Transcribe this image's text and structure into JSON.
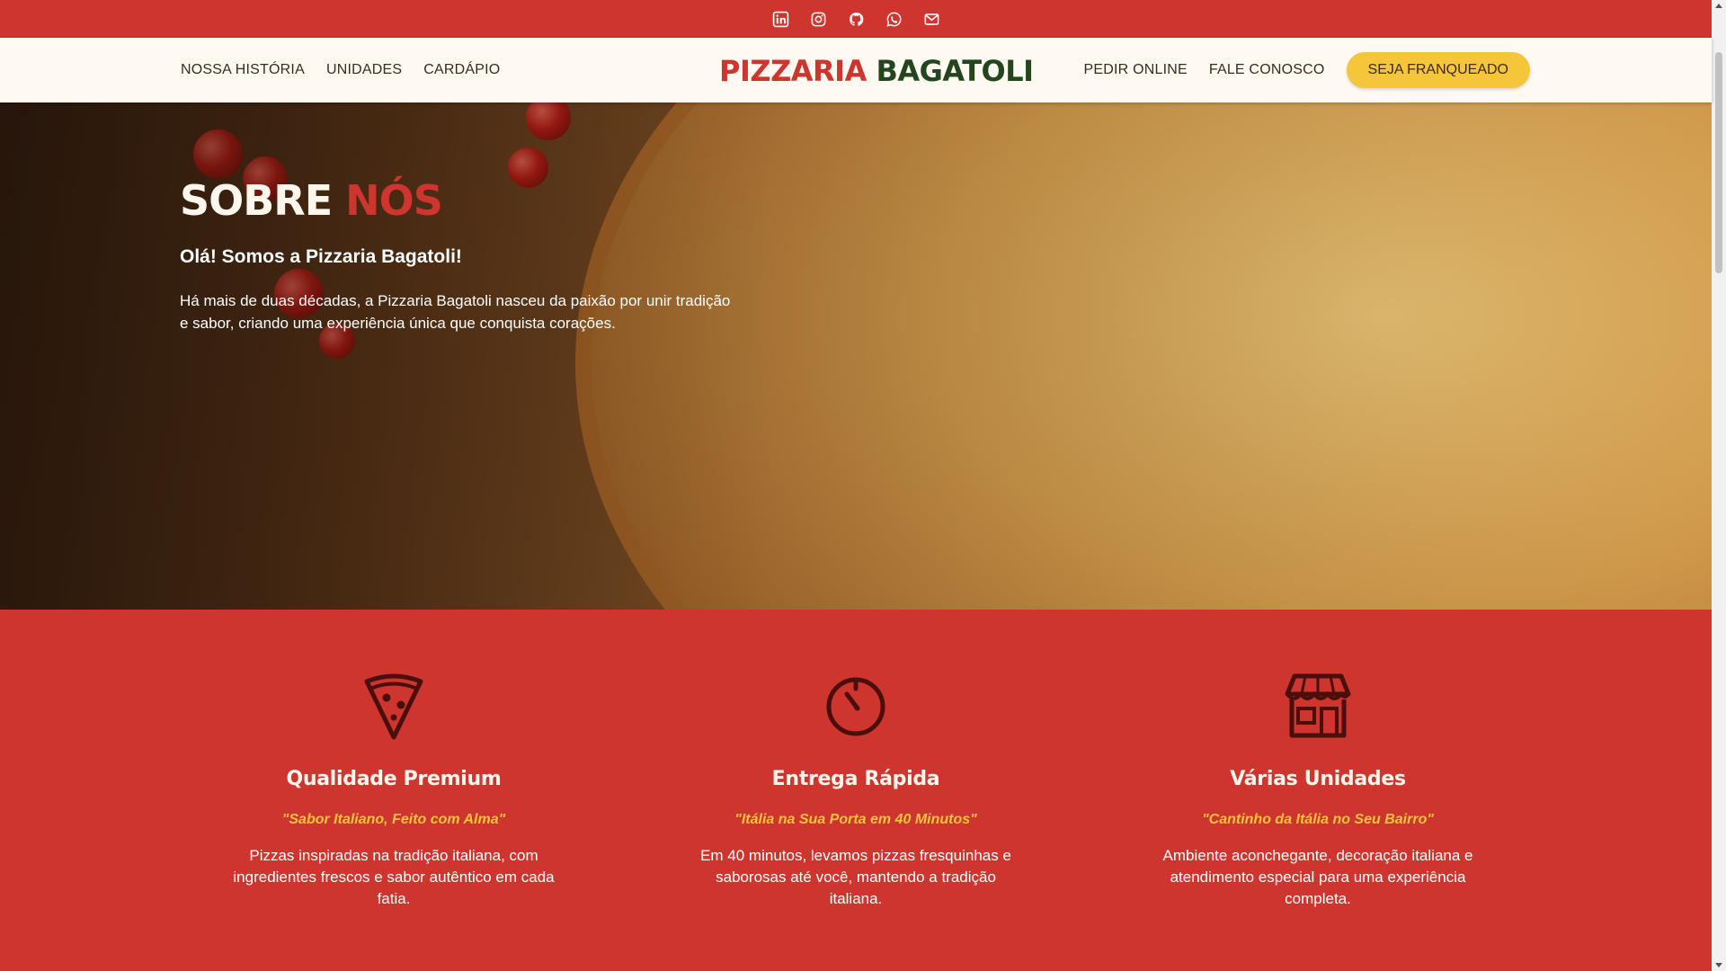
{
  "topbar": {
    "socials": [
      {
        "icon": "linkedin-icon"
      },
      {
        "icon": "instagram-icon"
      },
      {
        "icon": "github-icon"
      },
      {
        "icon": "whatsapp-icon"
      },
      {
        "icon": "email-icon"
      }
    ]
  },
  "nav": {
    "left": [
      "NOSSA HISTÓRIA",
      "UNIDADES",
      "CARDÁPIO"
    ],
    "logo_part1": "PIZZARIA",
    "logo_part2": "BAGATOLI",
    "right": [
      "PEDIR ONLINE",
      "FALE CONOSCO"
    ],
    "cta": "SEJA FRANQUEADO"
  },
  "hero": {
    "title_part1": "SOBRE",
    "title_part2": "NÓS",
    "subtitle": "Olá! Somos a Pizzaria Bagatoli!",
    "text": "Há mais de duas décadas, a Pizzaria Bagatoli nasceu da paixão por unir tradição e sabor, criando uma experiência única que conquista corações."
  },
  "features": [
    {
      "icon": "pizza-slice-icon",
      "title": "Qualidade Premium",
      "quote": "\"Sabor Italiano, Feito com Alma\"",
      "desc": "Pizzas inspiradas na tradição italiana, com ingredientes frescos e sabor autêntico em cada fatia."
    },
    {
      "icon": "timer-icon",
      "title": "Entrega Rápida",
      "quote": "\"Itália na Sua Porta em 40 Minutos\"",
      "desc": "Em 40 minutos, levamos pizzas fresquinhas e saborosas até você, mantendo a tradição italiana."
    },
    {
      "icon": "store-icon",
      "title": "Várias Unidades",
      "quote": "\"Cantinho da Itália no Seu Bairro\"",
      "desc": "Ambiente aconchegante, decoração italiana e atendimento especial para uma experiência completa."
    }
  ],
  "colors": {
    "brand_red": "#cf352f",
    "brand_green": "#24461e",
    "accent_yellow": "#f5c53a",
    "nav_bg": "#fffaf1",
    "icon_dark": "#4a0f0c"
  }
}
